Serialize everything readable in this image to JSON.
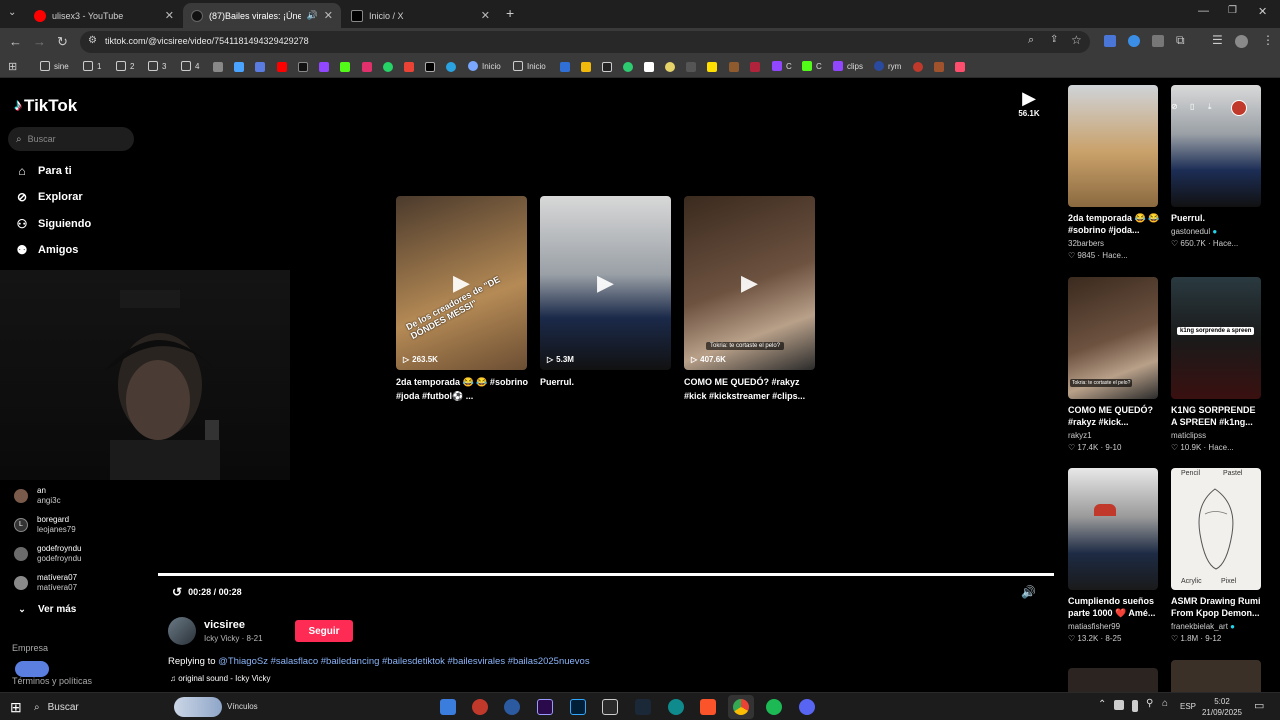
{
  "tabs": [
    {
      "title": "ulisex3 - YouTube",
      "color": "#ff0000"
    },
    {
      "title": "(87)Bailes virales: ¡Únete al",
      "color": "#222222"
    },
    {
      "title": "Inicio / X",
      "color": "#000000"
    }
  ],
  "addressbar": {
    "url": "tiktok.com/@vicsiree/video/7541181494329429278"
  },
  "bookmarks": {
    "items": [
      "sine",
      "1",
      "2",
      "3",
      "4",
      "Inicio",
      "Inicio",
      "C",
      "C",
      "clips",
      "rym"
    ]
  },
  "sidebar": {
    "logo": "TikTok",
    "search_placeholder": "Buscar",
    "nav": [
      "Para ti",
      "Explorar",
      "Siguiendo",
      "Amigos"
    ],
    "following": [
      {
        "name": "an",
        "user": "angi3c"
      },
      {
        "name": "boregard",
        "user": "leojanes79"
      },
      {
        "name": "godefroyndu",
        "user": "godefroyndu"
      },
      {
        "name": "matívera07",
        "user": "matívera07"
      }
    ],
    "more": "Ver más",
    "footer1": "Empresa",
    "footer2": "Términos y políticas"
  },
  "player": {
    "thumbs": [
      {
        "views": "263.5K",
        "caption": "2da temporada 😂 😂 #sobrino #joda #futbol⚽ ..."
      },
      {
        "views": "5.3M",
        "caption": "Puerrul."
      },
      {
        "views": "407.6K",
        "caption": "COMO ME QUEDÓ? #rakyz #kick #kickstreamer #clips..."
      }
    ],
    "time": "00:28 / 00:28",
    "progress": 1.0,
    "next_count": "56.1K"
  },
  "author": {
    "name": "vicsiree",
    "sub": "Icky Vicky · 8-21",
    "follow": "Seguir",
    "desc_prefix": "Replying to",
    "desc_tags": "@ThiagoSz #salasflaco #bailedancing #bailesdetiktok #bailesvirales #bailas2025nuevos",
    "sound": "♫ original sound - Icky Vicky"
  },
  "related": [
    {
      "title": "2da temporada 😂 😂 #sobrino #joda...",
      "author": "32barbers",
      "meta": "♡ 9845 · Hace..."
    },
    {
      "title": "Puerrul.",
      "author": "gastonedul",
      "meta": "♡ 650.7K · Hace..."
    },
    {
      "title": "COMO ME QUEDÓ? #rakyz #kick...",
      "author": "rakyz1",
      "meta": "♡ 17.4K · 9-10"
    },
    {
      "title": "K1NG SORPRENDE A SPREEN #k1ng...",
      "author": "maticlipss",
      "meta": "♡ 10.9K · Hace..."
    },
    {
      "title": "Cumpliendo sueños parte 1000 ❤️ Amé...",
      "author": "matiasfisher99",
      "meta": "♡ 13.2K · 8-25"
    },
    {
      "title": "ASMR Drawing Rumi From Kpop Demon...",
      "author": "franekbielak_art",
      "meta": "♡ 1.8M · 9-12"
    }
  ],
  "overlay_texts": {
    "thumb1": "De los creadores de \"DE DÓNDES MESSI\"",
    "thumb3": "Tokria: te cortaste el pelo?",
    "related4": "k1ng sorprende a spreen",
    "related6a": "Pencil",
    "related6b": "Pastel",
    "related6c": "Acrylic",
    "related6d": "Pixel"
  },
  "taskbar": {
    "search": "Buscar",
    "vinculos": "Vínculos",
    "lang": "ESP",
    "time": "5:02",
    "date": "21/09/2025"
  }
}
